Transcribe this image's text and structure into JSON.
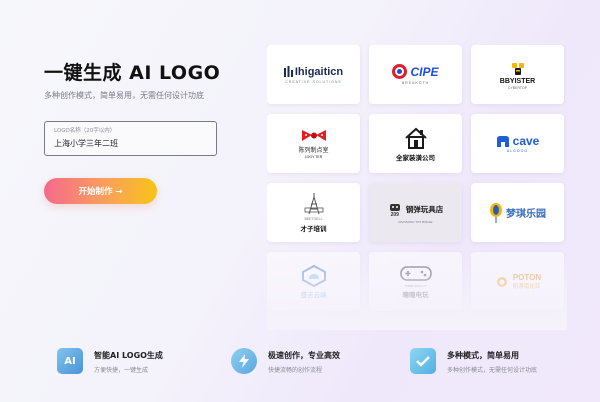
{
  "hero": {
    "title": "一键生成 AI LOGO",
    "subtitle": "多种创作模式，简单易用，无需任何设计功底",
    "name_field": {
      "label": "LOGO名称（20字以内）",
      "value": "上海小学三年二班"
    },
    "start_button": "开始制作 →"
  },
  "gallery": [
    {
      "name": "Ihigaiticn",
      "sub": "CREATIVE SOLUTIONS"
    },
    {
      "name": "CIPE",
      "sub": "BREAKOTH"
    },
    {
      "name": "BBYISTER",
      "sub": "CYBERTOP"
    },
    {
      "name": "陈列制点室",
      "sub": "LOGY TER"
    },
    {
      "name": "全家装潢公司",
      "sub": ""
    },
    {
      "name": "cave",
      "sub": "ALGOOO"
    },
    {
      "name": "才子培训",
      "sub": "BEETOELL"
    },
    {
      "name": "钢弹玩具店",
      "sub": "DIVOSONU TOX BOKAE",
      "badge": "209"
    },
    {
      "name": "梦琪乐园",
      "sub": ""
    },
    {
      "name": "盛吉云端",
      "sub": ""
    },
    {
      "name": "曈曈电玩",
      "sub": "TMMB NIGPLAY"
    },
    {
      "name": "POTON",
      "sub2": "奶茶南比亚"
    }
  ],
  "features": [
    {
      "icon": "AI",
      "title": "智能AI LOGO生成",
      "desc": "方便快捷，一键生成"
    },
    {
      "icon": "lightning",
      "title": "极速创作，专业高效",
      "desc": "快捷流畅的创作流程"
    },
    {
      "icon": "check",
      "title": "多种模式，简单易用",
      "desc": "多种创作模式，无需任何设计功底"
    }
  ],
  "colors": {
    "accent_gradient": [
      "#f56a8c",
      "#f9a05a",
      "#f7c417"
    ],
    "cipe_red": "#e01f2b",
    "cipe_blue": "#1d4fd8",
    "cave_blue": "#1d5fd6",
    "dream_blue": "#3a6ec2"
  }
}
